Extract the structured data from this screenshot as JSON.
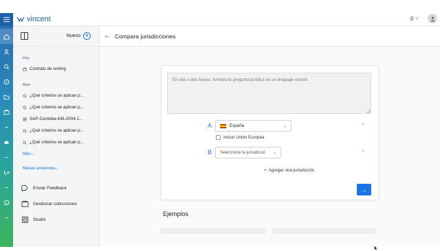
{
  "app": {
    "brand": "vincent",
    "credits_value": "0",
    "credits_unit": "V"
  },
  "panel": {
    "new_label": "Nuevo",
    "groups": [
      {
        "label": "Hoy",
        "items": [
          {
            "icon": "briefcase-icon",
            "text": "Contrato de renting"
          }
        ]
      },
      {
        "label": "Ayer",
        "items": [
          {
            "icon": "search-icon",
            "text": "¿Qué criterios se aplican p..."
          },
          {
            "icon": "search-icon",
            "text": "¿Qué criterios se aplican p..."
          },
          {
            "icon": "document-icon",
            "text": "SAP-Cordoba-436-2004-1..."
          },
          {
            "icon": "search-icon",
            "text": "¿Qué criterios se aplican p..."
          },
          {
            "icon": "search-icon",
            "text": "¿Qué criterios se aplican p..."
          }
        ]
      }
    ],
    "more_label": "Más...",
    "previous_label": "Meses anteriores...",
    "bottom": [
      {
        "icon": "chat-bubble-icon",
        "label": "Enviar Feedback"
      },
      {
        "icon": "collections-icon",
        "label": "Gestionar colecciones"
      },
      {
        "icon": "studio-icon",
        "label": "Studio"
      }
    ]
  },
  "main": {
    "title": "Compara jurisdicciones",
    "query_placeholder": "En una o dos frases, formula tu pregunta jurídica en un lenguaje común",
    "jurisdiction_a": {
      "letter": "A",
      "value": "España",
      "flag_colors": [
        "#c60b1e",
        "#ffc400"
      ]
    },
    "include_eu_label": "Incluir Unión Europea",
    "jurisdiction_b": {
      "letter": "B",
      "placeholder": "Seleccione la jurisdicció"
    },
    "add_label": "Agregar otra jurisdicción",
    "examples_title": "Ejemplos"
  },
  "colors": {
    "accent": "#1a73e8",
    "rail_top": "#2a6db5",
    "rail_bottom": "#3db55a"
  }
}
